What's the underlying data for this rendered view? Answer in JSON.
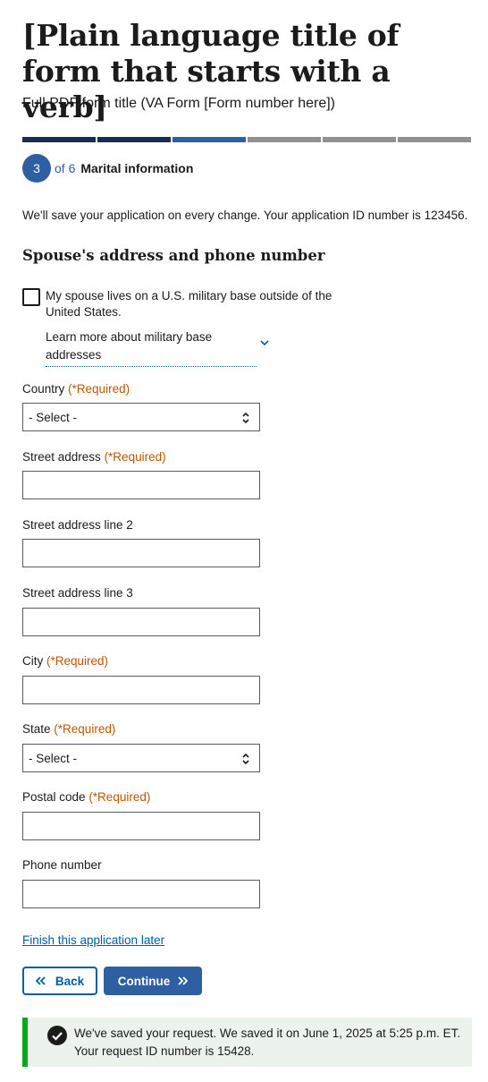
{
  "header": {
    "title": "[Plain language title of form that starts with a verb]",
    "subtitle": "Full PDF form title (VA Form [Form number here])"
  },
  "progress": {
    "total_segments": 6,
    "current_step": "3",
    "of_text": "of 6",
    "step_name": "Marital information"
  },
  "save_note": "We'll save your application on every change. Your application ID number is 123456.",
  "section_heading": "Spouse's address and phone number",
  "military_base": {
    "checkbox_label": "My spouse lives on a U.S. military base outside of the United States.",
    "checked": false,
    "learn_more": "Learn more about military base addresses"
  },
  "required_text": "(*Required)",
  "fields": {
    "country": {
      "label": "Country",
      "value": "- Select -"
    },
    "street": {
      "label": "Street address",
      "value": ""
    },
    "street2": {
      "label": "Street address line 2",
      "value": ""
    },
    "street3": {
      "label": "Street address line 3",
      "value": ""
    },
    "city": {
      "label": "City",
      "value": ""
    },
    "state": {
      "label": "State",
      "value": "- Select -"
    },
    "postal": {
      "label": "Postal code",
      "value": ""
    },
    "phone": {
      "label": "Phone number",
      "value": ""
    }
  },
  "finish_later": "Finish this application later",
  "buttons": {
    "back": "Back",
    "continue": "Continue"
  },
  "alert": {
    "message": "We've saved your request. We saved it on June 1, 2025 at 5:25 p.m. ET. Your request ID number is 15428."
  },
  "colors": {
    "primary": "#2e5fa3",
    "link": "#005ea2",
    "required": "#c05600",
    "success": "#00a91c",
    "success_bg": "#ecf3ec",
    "progress_complete": "#162e51",
    "progress_todo": "#919191"
  },
  "icons": {
    "learn_more": "chevron-down-icon",
    "select": "select-arrows-icon",
    "back": "double-chevron-left-icon",
    "continue": "double-chevron-right-icon",
    "alert": "check-circle-icon"
  }
}
